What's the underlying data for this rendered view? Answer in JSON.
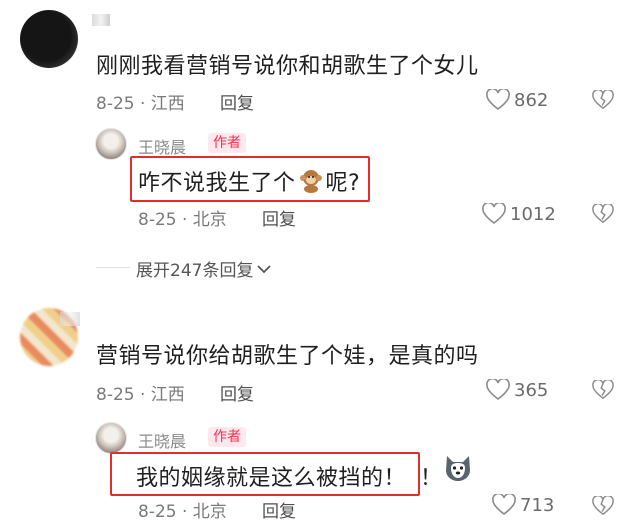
{
  "comments": [
    {
      "text": "刚刚我看营销号说你和胡歌生了个女儿",
      "date_location": "8-25 · 江西",
      "reply_label": "回复",
      "likes": "862",
      "author_reply": {
        "name": "王晓晨",
        "badge": "作者",
        "text_before": "咋不说我生了个",
        "text_after": "呢?",
        "emoji_icon": "monkey-icon",
        "date_location": "8-25 · 北京",
        "reply_label": "回复",
        "likes": "1012"
      },
      "expand_label": "展开247条回复"
    },
    {
      "text": "营销号说你给胡歌生了个娃，是真的吗",
      "date_location": "8-25 · 江西",
      "reply_label": "回复",
      "likes": "365",
      "author_reply": {
        "name": "王晓晨",
        "badge": "作者",
        "text": "我的姻缘就是这么被挡的！",
        "extra_text": "！",
        "emoji_icon": "husky-icon",
        "date_location": "8-25 · 北京",
        "reply_label": "回复",
        "likes": "713"
      }
    }
  ],
  "colors": {
    "highlight_box": "#e22d2d",
    "author_badge_text": "#ff2e4d",
    "author_badge_bg": "#ffe8ee"
  }
}
